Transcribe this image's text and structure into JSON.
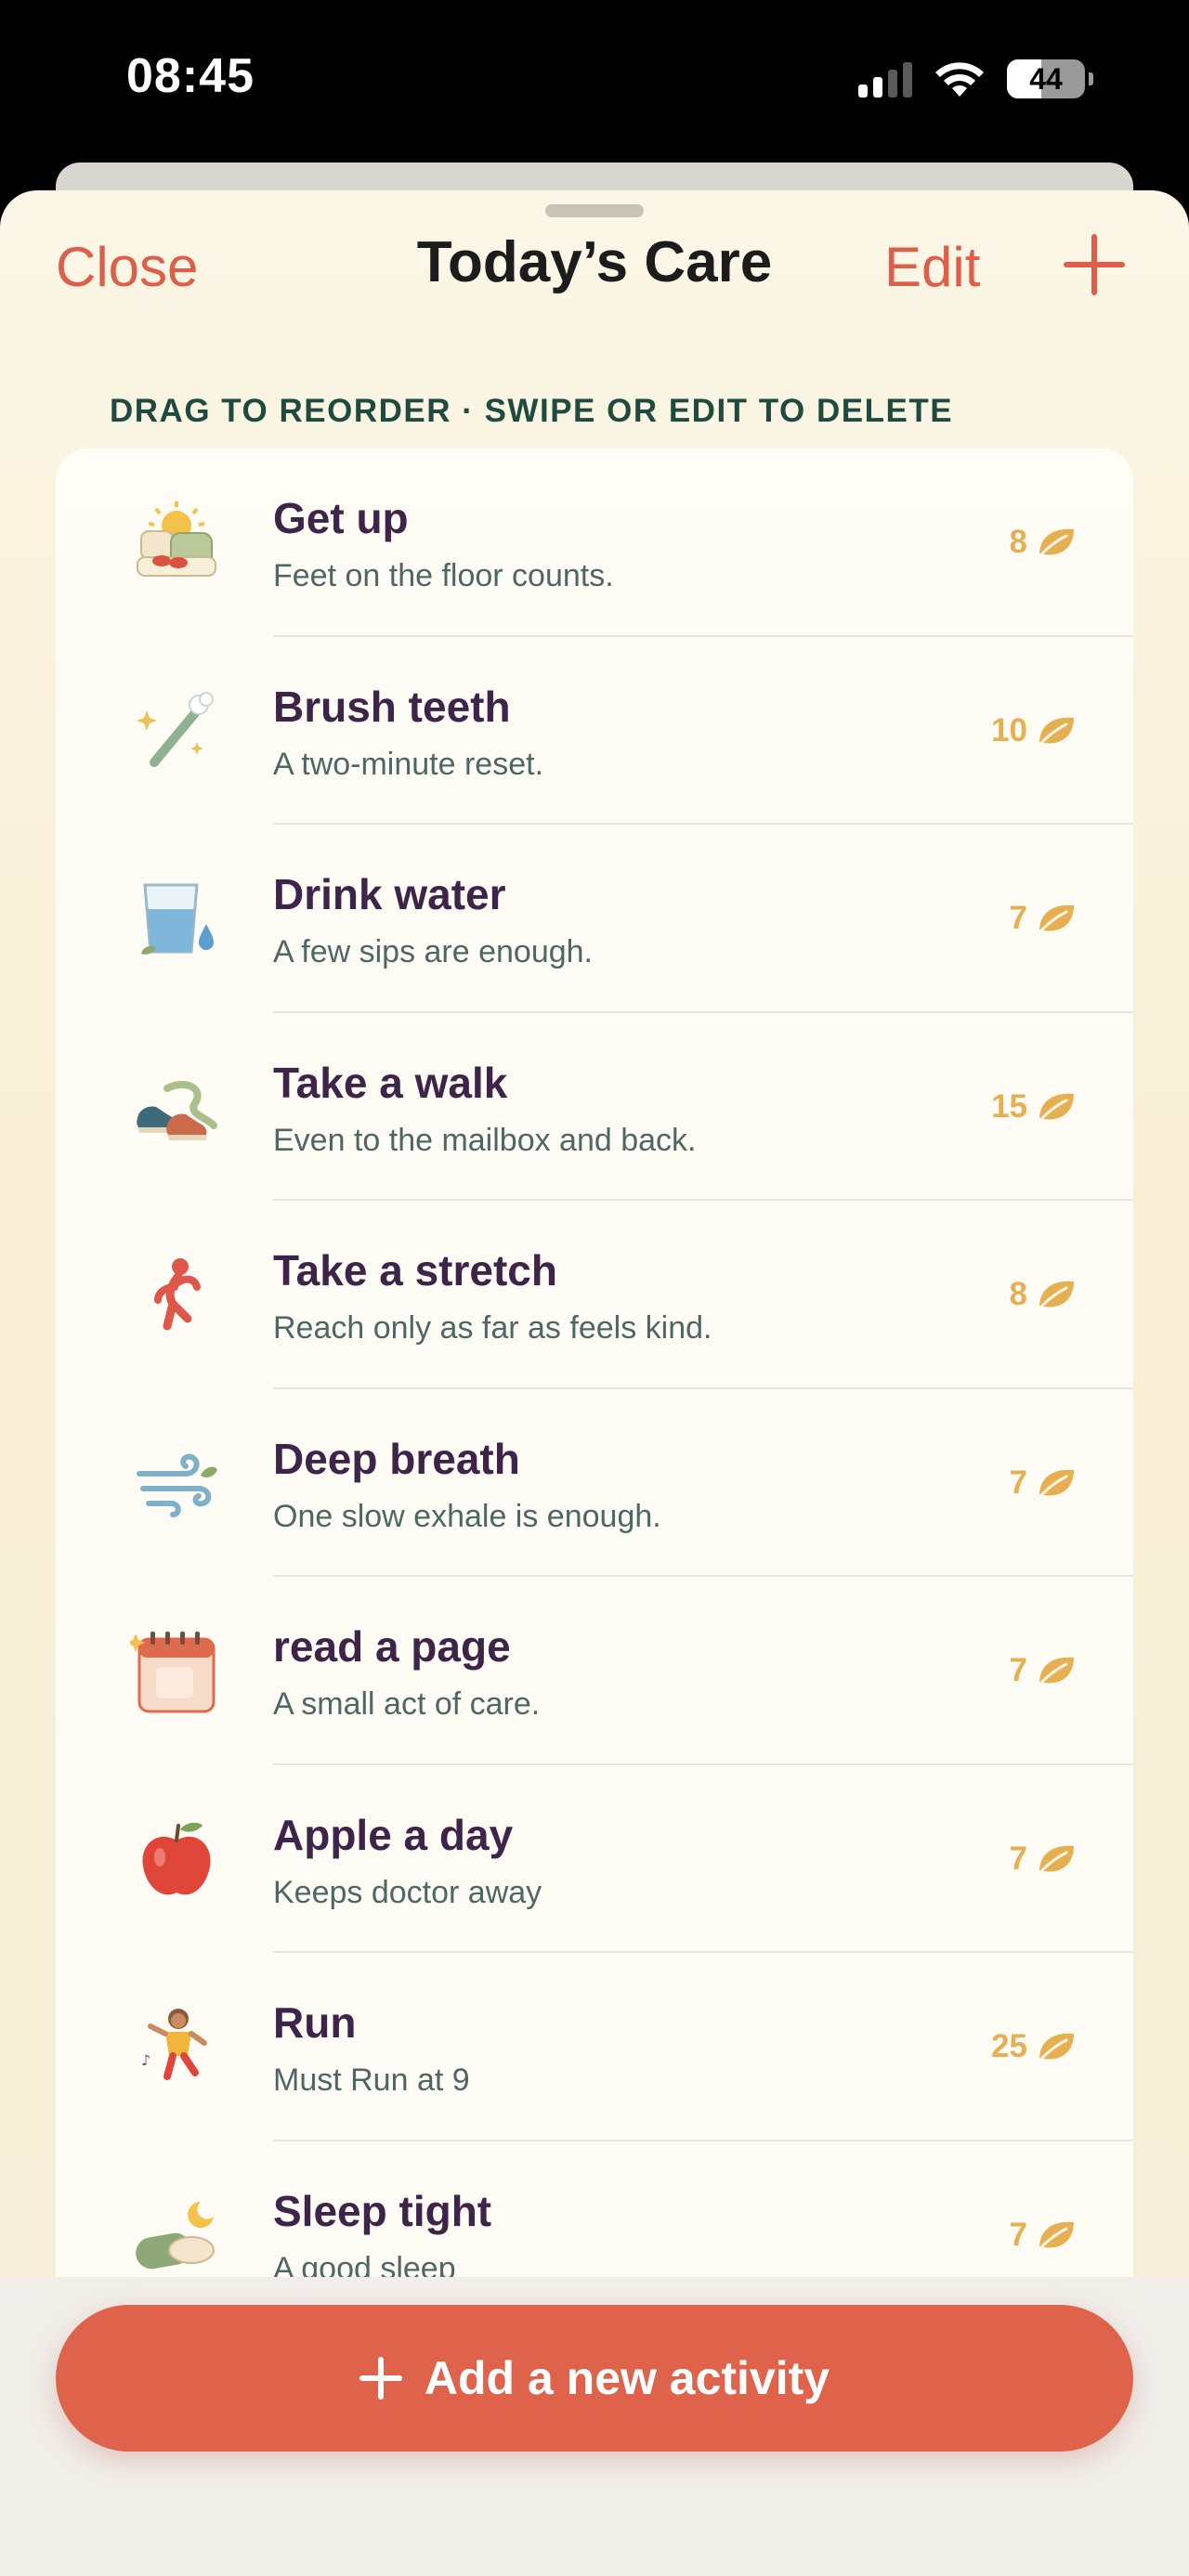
{
  "status_bar": {
    "time": "08:45",
    "battery": "44"
  },
  "nav": {
    "close_label": "Close",
    "title": "Today’s Care",
    "edit_label": "Edit"
  },
  "hint": "DRAG TO REORDER · SWIPE OR EDIT TO DELETE",
  "activities": [
    {
      "title": "Get up",
      "subtitle": "Feet on the floor counts.",
      "points": "8",
      "icon": "sunrise-bed-icon"
    },
    {
      "title": "Brush teeth",
      "subtitle": "A two-minute reset.",
      "points": "10",
      "icon": "toothbrush-icon"
    },
    {
      "title": "Drink water",
      "subtitle": "A few sips are enough.",
      "points": "7",
      "icon": "water-glass-icon"
    },
    {
      "title": "Take a walk",
      "subtitle": "Even to the mailbox and back.",
      "points": "15",
      "icon": "sneakers-icon"
    },
    {
      "title": "Take a stretch",
      "subtitle": "Reach only as far as feels kind.",
      "points": "8",
      "icon": "stretch-figure-icon"
    },
    {
      "title": "Deep breath",
      "subtitle": "One slow exhale is enough.",
      "points": "7",
      "icon": "wind-icon"
    },
    {
      "title": "read a page",
      "subtitle": "A small act of care.",
      "points": "7",
      "icon": "calendar-icon"
    },
    {
      "title": "Apple a day",
      "subtitle": "Keeps doctor away",
      "points": "7",
      "icon": "apple-icon"
    },
    {
      "title": "Run",
      "subtitle": "Must Run at 9",
      "points": "25",
      "icon": "running-child-icon"
    },
    {
      "title": "Sleep tight",
      "subtitle": "A good sleep",
      "points": "7",
      "icon": "sleep-mat-icon"
    }
  ],
  "add_button_label": "Add a new activity",
  "colors": {
    "accent": "#df634b",
    "points": "#e6b052",
    "title_text": "#3e2448",
    "subtitle_text": "#4d6864"
  }
}
